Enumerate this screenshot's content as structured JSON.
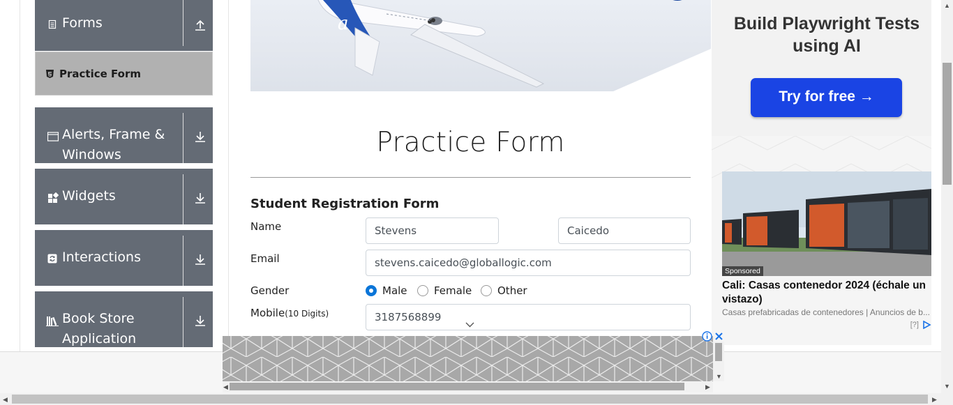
{
  "sidebar": {
    "groups": [
      {
        "label": "Forms",
        "icon": "document-icon",
        "expanded": true
      },
      {
        "label": "Alerts, Frame & Windows",
        "icon": "window-icon"
      },
      {
        "label": "Widgets",
        "icon": "widgets-icon"
      },
      {
        "label": "Interactions",
        "icon": "interactions-icon"
      },
      {
        "label": "Book Store Application",
        "icon": "books-icon"
      }
    ],
    "active_item": "Practice Form"
  },
  "main": {
    "title": "Practice Form",
    "form_heading": "Student Registration Form",
    "name_label": "Name",
    "first_name": "Stevens",
    "last_name": "Caicedo",
    "email_label": "Email",
    "email": "stevens.caicedo@globallogic.com",
    "gender_label": "Gender",
    "genders": [
      "Male",
      "Female",
      "Other"
    ],
    "gender_selected": "Male",
    "mobile_label": "Mobile",
    "mobile_hint": "(10 Digits)",
    "mobile": "3187568899"
  },
  "ads": {
    "top": {
      "headline": "Build Playwright Tests using AI",
      "button": "Try for free →"
    },
    "card": {
      "badge": "Sponsored",
      "title": "Cali: Casas contenedor 2024 (échale un vistazo)",
      "subtitle": "Casas prefabricadas de contenedores | Anuncios de b...",
      "help": "[?]"
    }
  },
  "colors": {
    "sidebar": "#646b75",
    "active_item": "#b1b1b1",
    "radio_on": "#0a75d8",
    "cta": "#1a44e4"
  }
}
